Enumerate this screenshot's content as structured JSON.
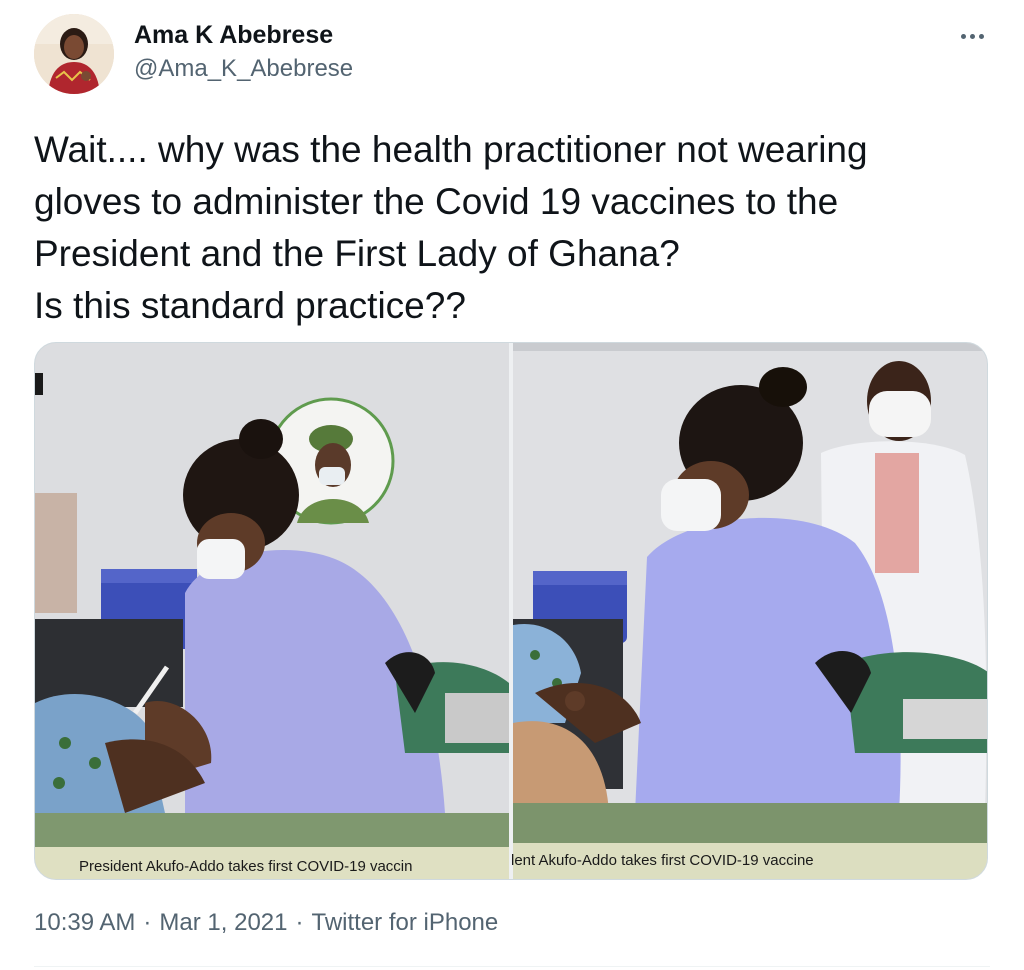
{
  "author": {
    "display_name": "Ama K Abebrese",
    "handle": "@Ama_K_Abebrese",
    "avatar_icon": "avatar-photo"
  },
  "more_icon": "more-options-icon",
  "tweet": {
    "text": "Wait.... why was the health practitioner not wearing\ngloves to administer the Covid 19 vaccines to the\nPresident and the First Lady of Ghana?\nIs this standard practice??"
  },
  "media": {
    "left_caption": "President Akufo-Addo takes first COVID-19 vaccin",
    "right_caption": "lent Akufo-Addo takes first COVID-19 vaccine",
    "scrub_color_left": "#a8a9e6",
    "scrub_color_right": "#a6aaee"
  },
  "meta": {
    "time": "10:39 AM",
    "date": "Mar 1, 2021",
    "source": "Twitter for iPhone"
  }
}
